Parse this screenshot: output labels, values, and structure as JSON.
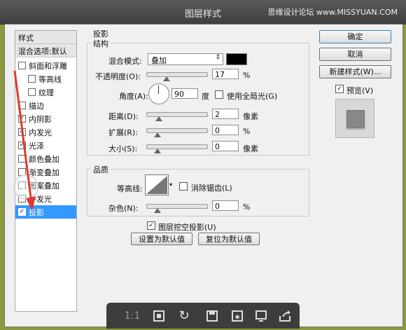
{
  "window": {
    "title": "图层样式",
    "watermark": "思缘设计论坛 www.MISSYUAN.COM"
  },
  "left_panel": {
    "header": "样式",
    "blend_options": "混合选项:默认",
    "items": [
      {
        "label": "斜面和浮雕",
        "checked": false
      },
      {
        "label": "等高线",
        "checked": false
      },
      {
        "label": "纹理",
        "checked": false
      },
      {
        "label": "描边",
        "checked": false
      },
      {
        "label": "内阴影",
        "checked": true
      },
      {
        "label": "内发光",
        "checked": true
      },
      {
        "label": "光泽",
        "checked": true
      },
      {
        "label": "颜色叠加",
        "checked": false
      },
      {
        "label": "渐变叠加",
        "checked": false
      },
      {
        "label": "图案叠加",
        "checked": false
      },
      {
        "label": "外发光",
        "checked": false
      },
      {
        "label": "投影",
        "checked": true,
        "selected": true
      }
    ]
  },
  "drop_shadow": {
    "section_title": "投影",
    "structure": {
      "title": "结构",
      "blend_mode_label": "混合模式:",
      "blend_mode_value": "叠加",
      "blend_color": "#000000",
      "opacity_label": "不透明度(O):",
      "opacity_value": "17",
      "opacity_unit": "%",
      "opacity_level": 0.17,
      "angle_label": "角度(A):",
      "angle_value": "90",
      "angle_unit": "度",
      "global_light_label": "使用全局光(G)",
      "global_light_checked": false,
      "distance_label": "距离(D):",
      "distance_value": "2",
      "distance_unit": "像素",
      "distance_level": 0.02,
      "spread_label": "扩展(R):",
      "spread_value": "0",
      "spread_unit": "%",
      "spread_level": 0,
      "size_label": "大小(S):",
      "size_value": "0",
      "size_unit": "像素",
      "size_level": 0
    },
    "quality": {
      "title": "品质",
      "contour_label": "等高线:",
      "antialias_label": "消除锯齿(L)",
      "antialias_checked": false,
      "noise_label": "杂色(N):",
      "noise_value": "0",
      "noise_unit": "%",
      "noise_level": 0
    },
    "knockout_label": "图层挖空投影(U)",
    "knockout_checked": true,
    "set_default": "设置为默认值",
    "reset_default": "复位为默认值"
  },
  "right_panel": {
    "ok": "确定",
    "cancel": "取消",
    "new_style": "新建样式(W)...",
    "preview_label": "预览(V)",
    "preview_checked": true
  },
  "viewer_toolbar": {
    "zoom_label": "1:1",
    "icons": [
      "fit-screen-icon",
      "rotate-icon",
      "save-icon",
      "favorite-icon",
      "slideshow-icon",
      "share-icon"
    ]
  }
}
